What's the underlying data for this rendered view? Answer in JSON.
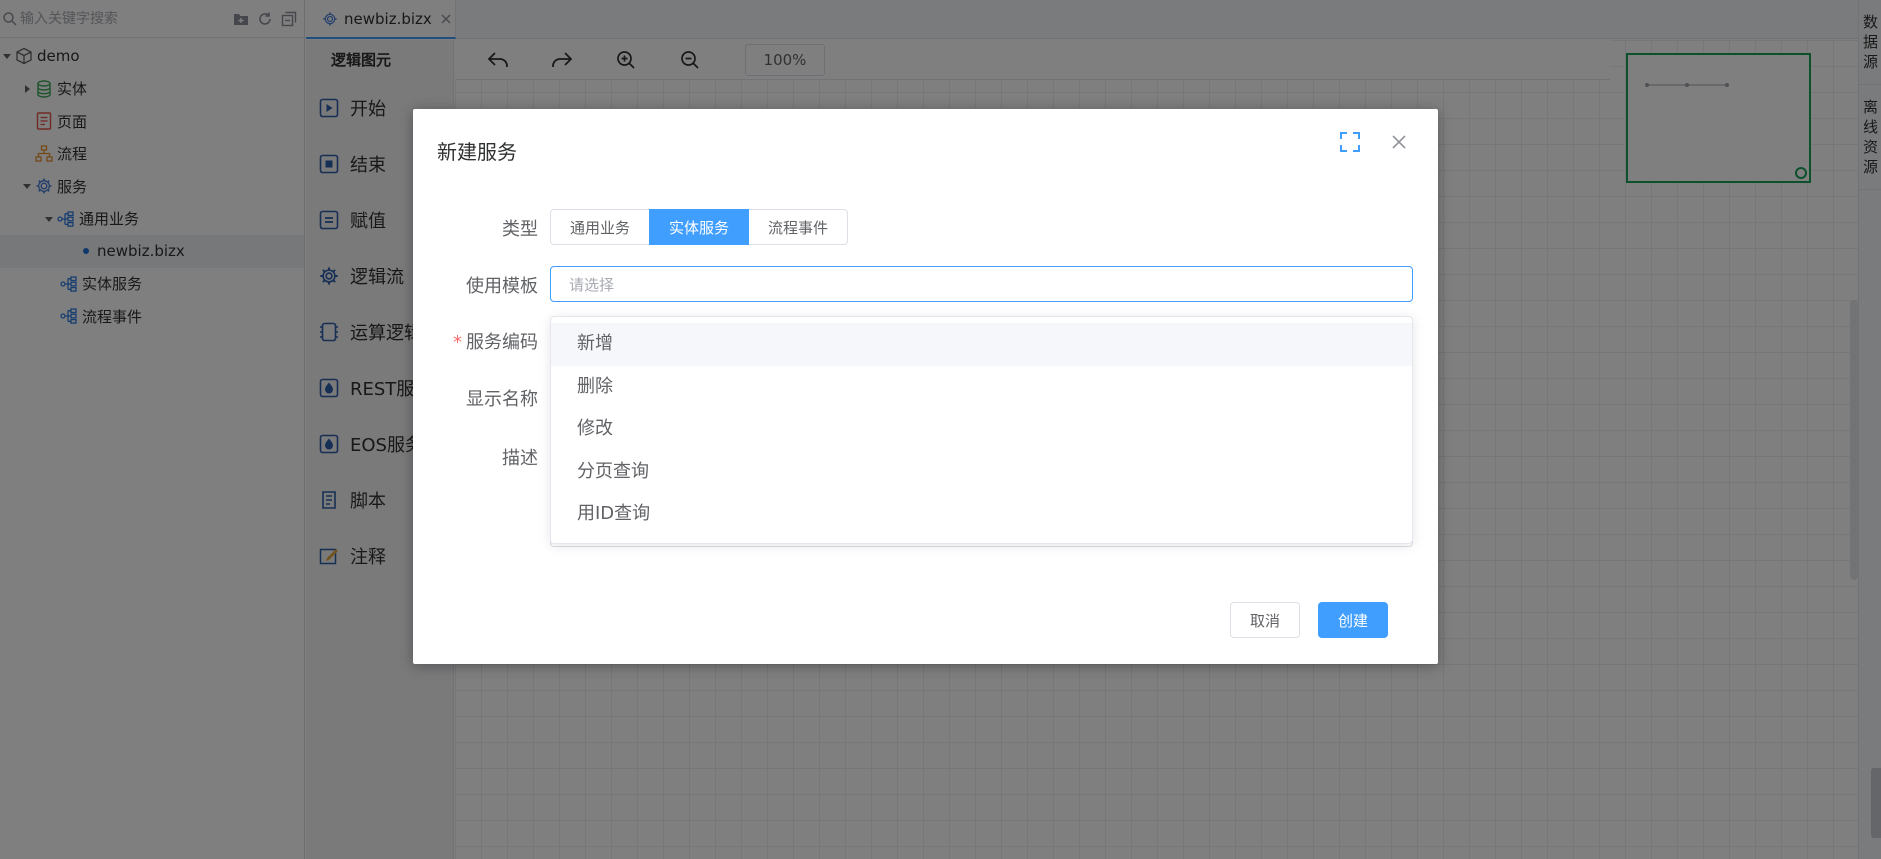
{
  "search": {
    "placeholder": "输入关键字搜索"
  },
  "tree": {
    "root": "demo",
    "entity": "实体",
    "page": "页面",
    "flow": "流程",
    "service": "服务",
    "general_biz": "通用业务",
    "file": "newbiz.bizx",
    "entity_service": "实体服务",
    "flow_event": "流程事件"
  },
  "tab": {
    "label": "newbiz.bizx"
  },
  "palette": {
    "title": "逻辑图元",
    "items": [
      "开始",
      "结束",
      "赋值",
      "逻辑流",
      "运算逻辑",
      "REST服务",
      "EOS服务",
      "脚本",
      "注释"
    ]
  },
  "toolbar": {
    "zoom": "100%"
  },
  "right_rail": {
    "datasource": "数据源",
    "offline": "离线资源"
  },
  "dialog": {
    "title": "新建服务",
    "labels": {
      "type": "类型",
      "template": "使用模板",
      "code": "服务编码",
      "display_name": "显示名称",
      "desc": "描述"
    },
    "required_mark": "*",
    "type_options": [
      "通用业务",
      "实体服务",
      "流程事件"
    ],
    "type_selected": "实体服务",
    "template_placeholder": "请选择",
    "template_options": [
      "新增",
      "删除",
      "修改",
      "分页查询",
      "用ID查询"
    ],
    "cancel": "取消",
    "create": "创建"
  },
  "colors": {
    "primary": "#409eff",
    "minimap_border": "#18a058",
    "required": "#f56c6c"
  }
}
